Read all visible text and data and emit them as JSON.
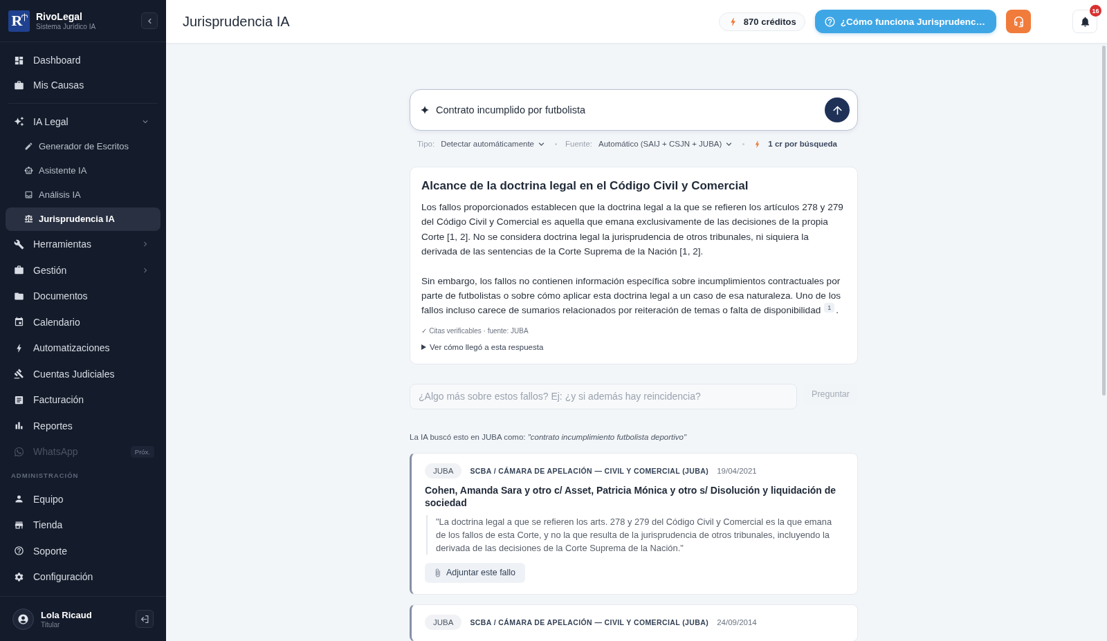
{
  "sidebar": {
    "logo_letter": "R",
    "brand": "RivoLegal",
    "tagline": "Sistema Jurídico IA",
    "sections": [
      {
        "items": [
          {
            "label": "Dashboard",
            "selected": false,
            "disabled": false
          },
          {
            "label": "Mis Causas",
            "selected": false,
            "disabled": false
          }
        ]
      },
      {
        "items": [
          {
            "label": "IA Legal",
            "selected": false,
            "disabled": false,
            "expanded": true,
            "children": [
              {
                "label": "Generador de Escritos",
                "selected": false
              },
              {
                "label": "Asistente IA",
                "selected": false
              },
              {
                "label": "Análisis IA",
                "selected": false
              },
              {
                "label": "Jurisprudencia IA",
                "selected": true
              }
            ]
          },
          {
            "label": "Herramientas",
            "selected": false,
            "disabled": false,
            "expanded": false
          },
          {
            "label": "Gestión",
            "selected": false,
            "disabled": false,
            "expanded": false
          },
          {
            "label": "Documentos",
            "selected": false,
            "disabled": false
          },
          {
            "label": "Calendario",
            "selected": false,
            "disabled": false
          },
          {
            "label": "Automatizaciones",
            "selected": false,
            "disabled": false
          },
          {
            "label": "Cuentas Judiciales",
            "selected": false,
            "disabled": false
          },
          {
            "label": "Facturación",
            "selected": false,
            "disabled": false
          },
          {
            "label": "Reportes",
            "selected": false,
            "disabled": false
          },
          {
            "label": "WhatsApp",
            "selected": false,
            "disabled": true,
            "badge": "Próx."
          }
        ]
      },
      {
        "heading": "ADMINISTRACIÓN",
        "items": [
          {
            "label": "Equipo",
            "selected": false,
            "disabled": false
          },
          {
            "label": "Tienda",
            "selected": false,
            "disabled": false
          },
          {
            "label": "Soporte",
            "selected": false,
            "disabled": false
          },
          {
            "label": "Configuración",
            "selected": false,
            "disabled": false
          }
        ]
      }
    ],
    "user": {
      "name": "Lola Ricaud",
      "role": "Titular"
    }
  },
  "header": {
    "title": "Jurisprudencia IA",
    "credits": "870 créditos",
    "help_button": "¿Cómo funciona Jurisprudenc…",
    "notifications_badge": "16"
  },
  "search": {
    "value": "Contrato incumplido por futbolista",
    "options": [
      {
        "label": "Tipo:",
        "value": "Detectar automáticamente"
      },
      {
        "label": "Fuente:",
        "value": "Automático (SAIJ + CSJN + JUBA)"
      }
    ],
    "cost": "1 cr por búsqueda"
  },
  "answer": {
    "title": "Alcance de la doctrina legal en el Código Civil y Comercial",
    "paragraphs": [
      {
        "text": "Los fallos proporcionados establecen que la doctrina legal a la que se refieren los artículos 278 y 279 del Código Civil y Comercial es aquella que emana exclusivamente de las decisiones de la propia Corte [1, 2]. No se considera doctrina legal la jurisprudencia de otros tribunales, ni siquiera la derivada de las sentencias de la Corte Suprema de la Nación [1, 2]."
      },
      {
        "text": "Sin embargo, los fallos no contienen información específica sobre incumplimientos contractuales por parte de futbolistas o sobre cómo aplicar esta doctrina legal a un caso de esa naturaleza. Uno de los fallos incluso carece de sumarios relacionados por reiteración de temas o falta de disponibilidad",
        "citation": "1",
        "tail": "."
      }
    ],
    "verification": "✓ Citas verificables · fuente: JUBA",
    "details_toggle": {
      "label": "Ver cómo llegó a esta respuesta",
      "expanded": false
    }
  },
  "follow_up": {
    "placeholder": "¿Algo más sobre estos fallos? Ej: ¿y si además hay reincidencia?",
    "button": "Preguntar",
    "button_disabled": true
  },
  "query_note": "La IA buscó esto en JUBA como: *\"contrato incumplimiento futbolista deportivo\"*",
  "results": [
    {
      "source": "JUBA",
      "court": "SCBA / CÁMARA DE APELACIÓN — CIVIL Y COMERCIAL (JUBA)",
      "date": "19/04/2021",
      "title": "Cohen, Amanda Sara y otro c/ Asset, Patricia Mónica y otro s/ Disolución y liquidación de sociedad",
      "quote": "\"La doctrina legal a que se refieren los arts. 278 y 279 del Código Civil y Comercial es la que emana de los fallos de esta Corte, y no la que resulta de la jurisprudencia de otros tribunales, incluyendo la derivada de las decisiones de la Corte Suprema de la Nación.\"",
      "action": "Adjuntar este fallo"
    },
    {
      "source": "JUBA",
      "court": "SCBA / CÁMARA DE APELACIÓN — CIVIL Y COMERCIAL (JUBA)",
      "date": "24/09/2014"
    }
  ]
}
